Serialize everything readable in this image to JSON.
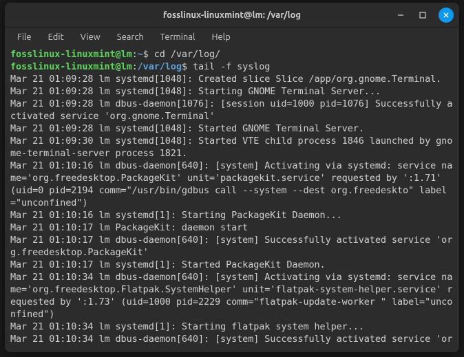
{
  "window": {
    "title": "fosslinux-linuxmint@lm: /var/log"
  },
  "menu": {
    "file": "File",
    "edit": "Edit",
    "view": "View",
    "search": "Search",
    "terminal": "Terminal",
    "help": "Help"
  },
  "prompt1": {
    "user": "fosslinux-linuxmint@lm",
    "sep": ":",
    "path": "~",
    "sym": "$",
    "cmd": "cd /var/log/"
  },
  "prompt2": {
    "user": "fosslinux-linuxmint@lm",
    "sep": ":",
    "path": "/var/log",
    "sym": "$",
    "cmd": "tail -f syslog"
  },
  "logs": {
    "l0": "Mar 21 01:09:28 lm systemd[1048]: Created slice Slice /app/org.gnome.Terminal.",
    "l1": "Mar 21 01:09:28 lm systemd[1048]: Starting GNOME Terminal Server...",
    "l2": "Mar 21 01:09:28 lm dbus-daemon[1076]: [session uid=1000 pid=1076] Successfully activated service 'org.gnome.Terminal'",
    "l3": "Mar 21 01:09:28 lm systemd[1048]: Started GNOME Terminal Server.",
    "l4": "Mar 21 01:09:30 lm systemd[1048]: Started VTE child process 1846 launched by gnome-terminal-server process 1821.",
    "l5": "Mar 21 01:10:16 lm dbus-daemon[640]: [system] Activating via systemd: service name='org.freedesktop.PackageKit' unit='packagekit.service' requested by ':1.71' (uid=0 pid=2194 comm=\"/usr/bin/gdbus call --system --dest org.freedeskto\" label=\"unconfined\")",
    "l6": "Mar 21 01:10:16 lm systemd[1]: Starting PackageKit Daemon...",
    "l7": "Mar 21 01:10:17 lm PackageKit: daemon start",
    "l8": "Mar 21 01:10:17 lm dbus-daemon[640]: [system] Successfully activated service 'org.freedesktop.PackageKit'",
    "l9": "Mar 21 01:10:17 lm systemd[1]: Started PackageKit Daemon.",
    "l10": "Mar 21 01:10:34 lm dbus-daemon[640]: [system] Activating via systemd: service name='org.freedesktop.Flatpak.SystemHelper' unit='flatpak-system-helper.service' requested by ':1.73' (uid=1000 pid=2229 comm=\"flatpak-update-worker               \" label=\"unconfined\")",
    "l11": "Mar 21 01:10:34 lm systemd[1]: Starting flatpak system helper...",
    "l12": "Mar 21 01:10:34 lm dbus-daemon[640]: [system] Successfully activated service 'or"
  }
}
